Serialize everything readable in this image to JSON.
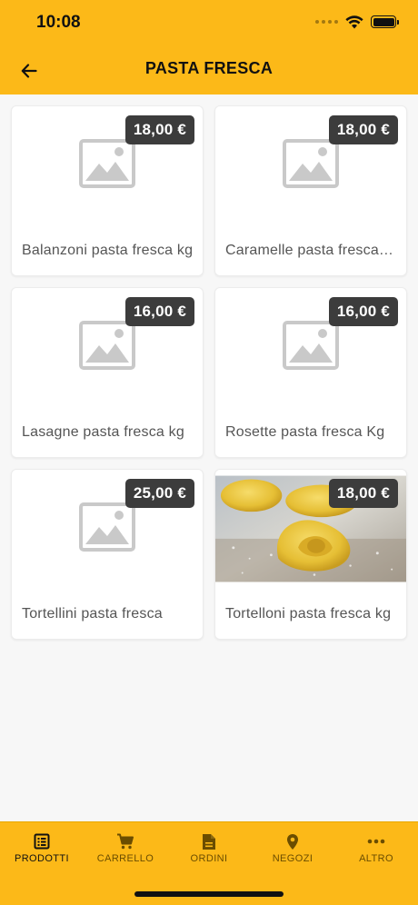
{
  "status_bar": {
    "time": "10:08"
  },
  "header": {
    "title": "PASTA FRESCA"
  },
  "products": [
    {
      "name": "Balanzoni pasta fresca kg",
      "price": "18,00 €",
      "image": "placeholder-image"
    },
    {
      "name": "Caramelle pasta fresca kg",
      "price": "18,00 €",
      "image": "placeholder-image"
    },
    {
      "name": "Lasagne pasta fresca kg",
      "price": "16,00 €",
      "image": "placeholder-image"
    },
    {
      "name": "Rosette pasta fresca Kg",
      "price": "16,00 €",
      "image": "placeholder-image"
    },
    {
      "name": "Tortellini pasta fresca",
      "price": "25,00 €",
      "image": "placeholder-image"
    },
    {
      "name": "Tortelloni pasta fresca kg",
      "price": "18,00 €",
      "image": "tortelloni-photo"
    }
  ],
  "tabbar": {
    "items": [
      {
        "label": "PRODOTTI",
        "icon": "list-icon",
        "active": true
      },
      {
        "label": "CARRELLO",
        "icon": "cart-icon",
        "active": false
      },
      {
        "label": "ORDINI",
        "icon": "document-icon",
        "active": false
      },
      {
        "label": "NEGOZI",
        "icon": "location-pin-icon",
        "active": false
      },
      {
        "label": "ALTRO",
        "icon": "more-icon",
        "active": false
      }
    ]
  },
  "colors": {
    "brand_yellow": "#fcb918",
    "price_badge": "#3c3c3c",
    "inactive_tab": "#6b4d00"
  }
}
